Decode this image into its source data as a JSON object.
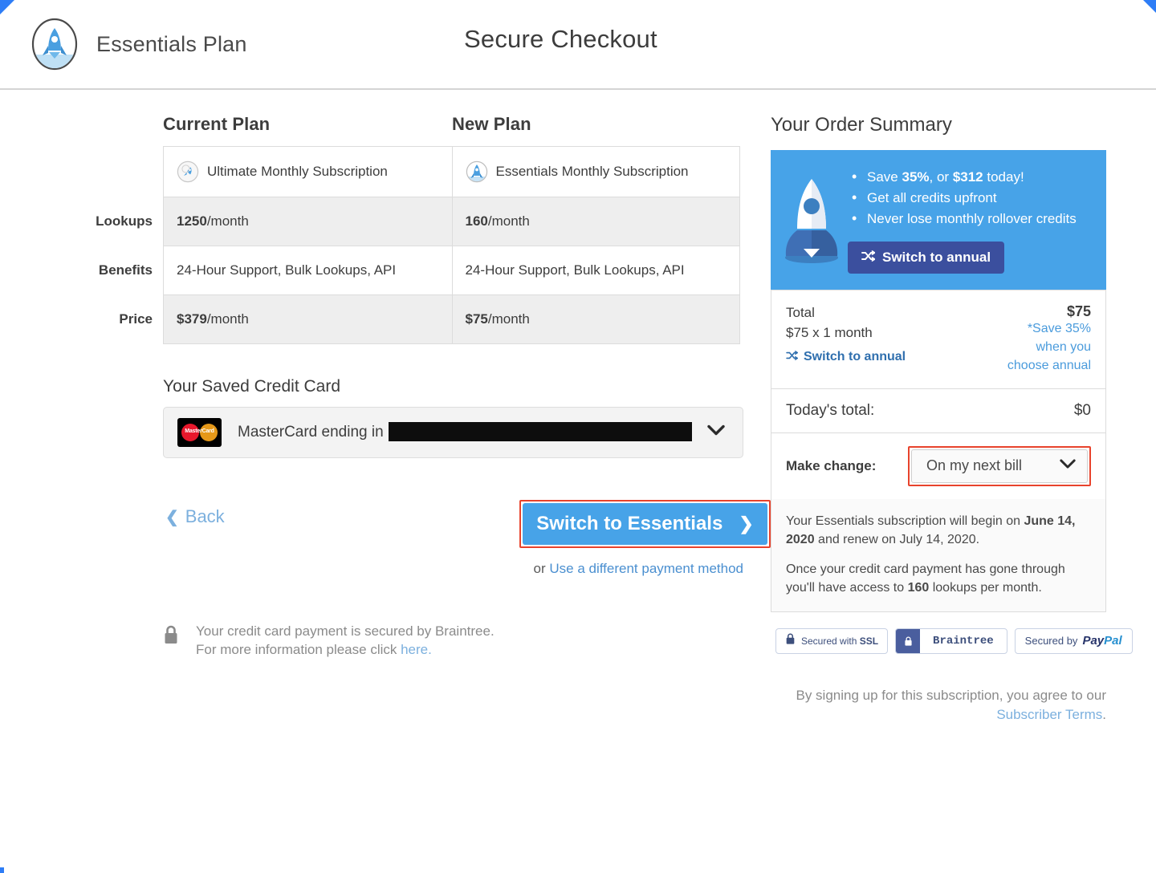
{
  "header": {
    "brand_name": "Essentials Plan",
    "page_title": "Secure Checkout",
    "logo_icon": "rocket-oval-icon"
  },
  "comparison": {
    "col_current": "Current Plan",
    "col_new": "New Plan",
    "row_labels": {
      "lookups": "Lookups",
      "benefits": "Benefits",
      "price": "Price"
    },
    "current": {
      "plan_name": "Ultimate Monthly Subscription",
      "plan_icon": "rocket-ultimate-icon",
      "lookups_value": "1250",
      "lookups_suffix": "/month",
      "benefits": "24-Hour Support, Bulk Lookups, API",
      "price_value": "$379",
      "price_suffix": "/month"
    },
    "new": {
      "plan_name": "Essentials Monthly Subscription",
      "plan_icon": "rocket-essentials-icon",
      "lookups_value": "160",
      "lookups_suffix": "/month",
      "benefits": "24-Hour Support, Bulk Lookups, API",
      "price_value": "$75",
      "price_suffix": "/month"
    }
  },
  "payment": {
    "section_title": "Your Saved Credit Card",
    "card_brand_icon": "mastercard-icon",
    "card_brand_text": "MasterCard",
    "card_label": "MasterCard ending in",
    "card_number_redacted": "",
    "dropdown_icon": "chevron-down-icon"
  },
  "actions": {
    "back_label": "Back",
    "back_icon": "chevron-left-icon",
    "cta_label": "Switch to Essentials",
    "cta_icon": "chevron-right-icon",
    "alt_prefix": "or ",
    "alt_link": "Use a different payment method"
  },
  "secure_note": {
    "lock_icon": "lock-icon",
    "line1": "Your credit card payment is secured by Braintree.",
    "line2_prefix": "For more information please click ",
    "line2_link": "here."
  },
  "summary": {
    "title": "Your Order Summary",
    "promo": {
      "rocket_icon": "rocket-illustration-icon",
      "bullets": [
        {
          "pre": "Save ",
          "b1": "35%",
          "mid": ", or ",
          "b2": "$312",
          "post": " today!"
        },
        {
          "pre": "Get all credits upfront",
          "b1": "",
          "mid": "",
          "b2": "",
          "post": ""
        },
        {
          "pre": "Never lose monthly rollover credits",
          "b1": "",
          "mid": "",
          "b2": "",
          "post": ""
        }
      ],
      "button_label": "Switch to annual",
      "button_icon": "shuffle-icon"
    },
    "total": {
      "label": "Total",
      "detail": "$75 x 1 month",
      "amount": "$75",
      "save_note": "*Save 35% when you choose annual",
      "switch_link": "Switch to annual",
      "switch_icon": "shuffle-icon"
    },
    "today": {
      "label": "Today's total:",
      "amount": "$0"
    },
    "make_change": {
      "label": "Make change:",
      "selected": "On my next bill",
      "dropdown_icon": "chevron-down-icon"
    },
    "info": {
      "p1_pre": "Your Essentials subscription will begin on ",
      "p1_bold": "June 14, 2020",
      "p1_post": " and renew on July 14, 2020.",
      "p2_pre": "Once your credit card payment has gone through you'll have access to ",
      "p2_bold": "160",
      "p2_post": " lookups per month."
    },
    "badges": {
      "ssl_prefix": "Secured with ",
      "ssl_bold": "SSL",
      "braintree": "Braintree",
      "paypal_prefix": "Secured by ",
      "paypal_p1": "Pay",
      "paypal_p2": "Pal",
      "lock_icon": "lock-icon"
    },
    "terms": {
      "prefix": "By signing up for this subscription, you agree to our ",
      "link": "Subscriber Terms",
      "suffix": "."
    }
  },
  "colors": {
    "accent_blue": "#47a3e8",
    "link_blue": "#7cb0de",
    "highlight_red": "#e8432c",
    "promo_button": "#3b4f9e"
  }
}
